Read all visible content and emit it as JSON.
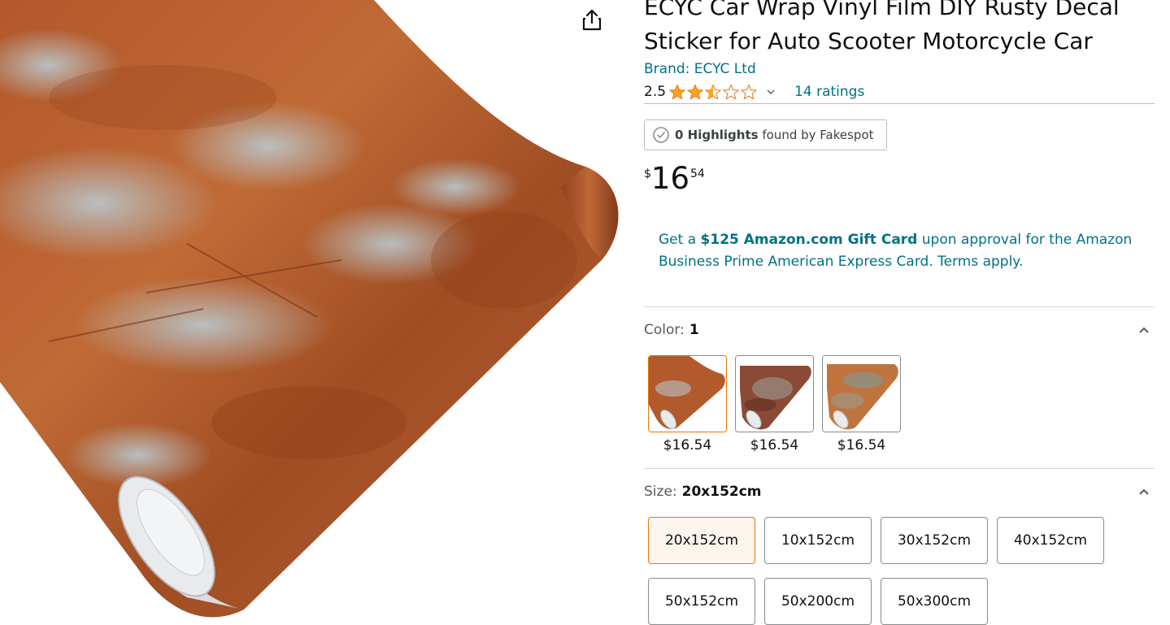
{
  "product": {
    "title": "ECYC Car Wrap Vinyl Film DIY Rusty Decal Sticker for Auto Scooter Motorcycle Car",
    "brand_label": "Brand: ECYC Ltd",
    "rating_value": "2.5",
    "rating_stars": 2.5,
    "ratings_count_label": "14 ratings"
  },
  "fakespot": {
    "count": "0 Highlights",
    "suffix": "found by Fakespot"
  },
  "price": {
    "symbol": "$",
    "whole": "16",
    "fraction": "54"
  },
  "promo": {
    "prefix": "Get a ",
    "highlight": "$125 Amazon.com Gift Card",
    "suffix": " upon approval for the Amazon Business Prime American Express Card. Terms apply."
  },
  "color": {
    "label": "Color:",
    "selected": "1",
    "options": [
      {
        "price": "$16.54",
        "selected": true
      },
      {
        "price": "$16.54",
        "selected": false
      },
      {
        "price": "$16.54",
        "selected": false
      }
    ]
  },
  "size": {
    "label": "Size:",
    "selected": "20x152cm",
    "options": [
      "20x152cm",
      "10x152cm",
      "30x152cm",
      "40x152cm",
      "50x152cm",
      "50x200cm",
      "50x300cm"
    ]
  },
  "colors": {
    "link": "#007185",
    "star": "#ffa41c",
    "rust": "#b0542a",
    "selected_border": "#e77600"
  },
  "icons": {
    "share": "share-icon",
    "chevron": "chevron-down-icon",
    "caret_up": "chevron-up-icon",
    "check": "check-circle-icon"
  }
}
